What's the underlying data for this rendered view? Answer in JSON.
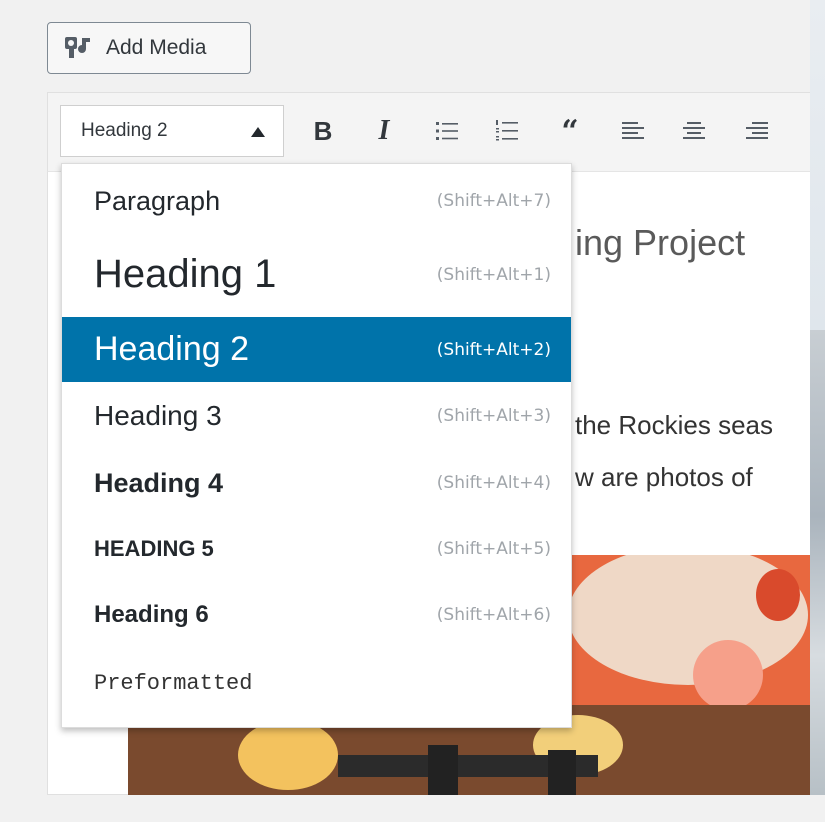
{
  "toolbar": {
    "add_media_label": "Add Media",
    "format_value": "Heading 2",
    "bold_label": "B",
    "italic_label": "I",
    "quote_label": "“",
    "icons": [
      "bulleted-list-icon",
      "numbered-list-icon",
      "blockquote-icon",
      "align-left-icon",
      "align-center-icon",
      "align-right-icon"
    ]
  },
  "content": {
    "title_fragment": "ing Project",
    "line1_fragment": "the Rockies seas",
    "line2_fragment": "w are photos of"
  },
  "dropdown": {
    "selected_index": 2,
    "items": [
      {
        "name": "Paragraph",
        "shortcut": "(Shift+Alt+7)"
      },
      {
        "name": "Heading 1",
        "shortcut": "(Shift+Alt+1)"
      },
      {
        "name": "Heading 2",
        "shortcut": "(Shift+Alt+2)"
      },
      {
        "name": "Heading 3",
        "shortcut": "(Shift+Alt+3)"
      },
      {
        "name": "Heading 4",
        "shortcut": "(Shift+Alt+4)"
      },
      {
        "name": "HEADING 5",
        "shortcut": "(Shift+Alt+5)"
      },
      {
        "name": "Heading 6",
        "shortcut": "(Shift+Alt+6)"
      },
      {
        "name": "Preformatted",
        "shortcut": ""
      }
    ]
  },
  "colors": {
    "selected_bg": "#0073aa",
    "shortcut_text": "#a0a5aa",
    "toolbar_bg": "#f4f4f4"
  }
}
